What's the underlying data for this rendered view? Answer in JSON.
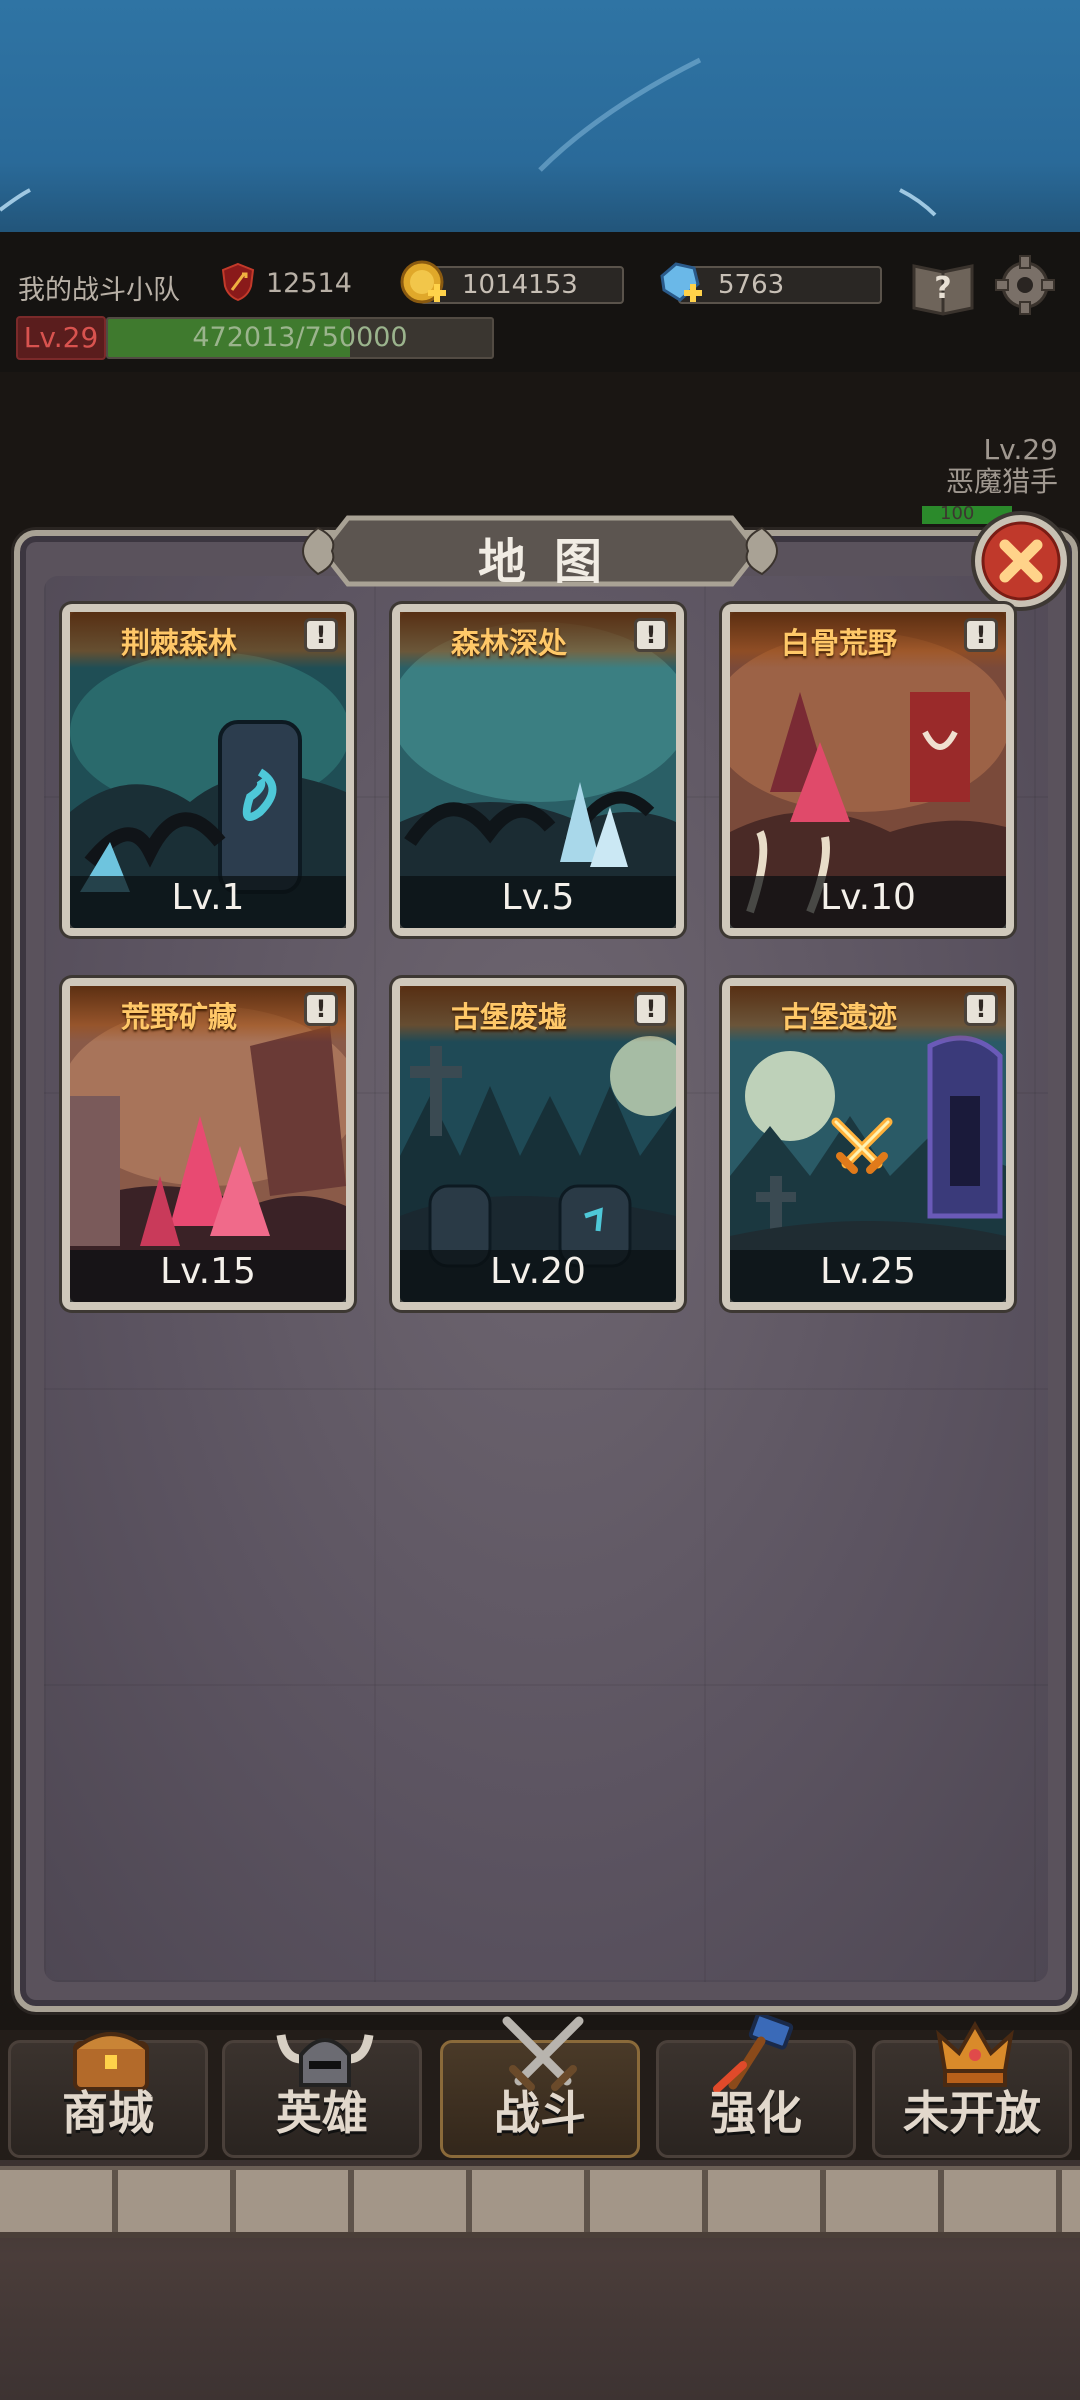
{
  "header": {
    "team_name": "我的战斗小队",
    "power": "12514",
    "gold": "1014153",
    "gems": "5763",
    "level_badge": "Lv.29",
    "xp_text": "472013/750000",
    "xp_fraction": 0.629
  },
  "enemy": {
    "level": "Lv.29",
    "name": "恶魔猎手",
    "hp_text": "100"
  },
  "map_dialog": {
    "title": "地图",
    "maps": [
      {
        "name": "荆棘森林",
        "level": "Lv.1"
      },
      {
        "name": "森林深处",
        "level": "Lv.5"
      },
      {
        "name": "白骨荒野",
        "level": "Lv.10"
      },
      {
        "name": "荒野矿藏",
        "level": "Lv.15"
      },
      {
        "name": "古堡废墟",
        "level": "Lv.20"
      },
      {
        "name": "古堡遗迹",
        "level": "Lv.25"
      }
    ],
    "info_glyph": "!"
  },
  "nav": {
    "items": [
      {
        "label": "商城",
        "icon": "treasure-chest-icon"
      },
      {
        "label": "英雄",
        "icon": "viking-helmet-icon"
      },
      {
        "label": "战斗",
        "icon": "crossed-swords-icon",
        "active": true
      },
      {
        "label": "强化",
        "icon": "hammer-icon"
      },
      {
        "label": "未开放",
        "icon": "crown-icon"
      }
    ]
  }
}
